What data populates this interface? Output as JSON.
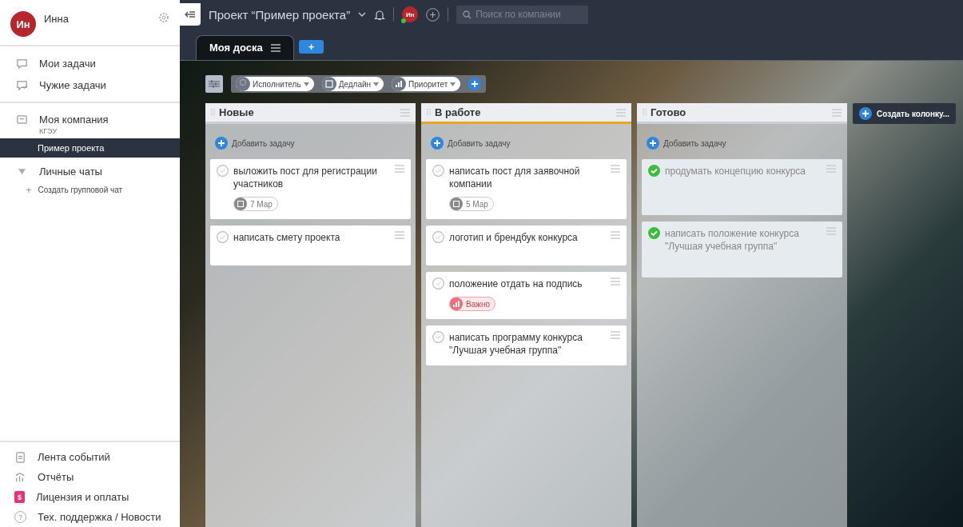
{
  "user": {
    "initials": "Ин",
    "name": "Инна"
  },
  "nav": [
    {
      "label": "Мои задачи",
      "kind": "tasks"
    },
    {
      "label": "Чужие задачи",
      "kind": "others"
    }
  ],
  "company": {
    "name": "Моя компания",
    "subtitle": "КГЭУ",
    "projects": [
      {
        "label": "Пример проекта",
        "selected": true
      }
    ]
  },
  "chats": {
    "label": "Личные чаты",
    "expanded": true,
    "create": "Создать групповой чат",
    "create_icon": "+"
  },
  "footer_nav": [
    {
      "label": "Лента событий",
      "kind": "feed"
    },
    {
      "label": "Отчёты",
      "kind": "reports"
    },
    {
      "label": "Лицензия и оплаты",
      "kind": "license",
      "icon_text": "$"
    },
    {
      "label": "Тех. поддержка / Новости",
      "kind": "help",
      "icon_text": "?"
    }
  ],
  "topbar": {
    "project_title": "Проект “Пример проекта”",
    "avatar": "Ин",
    "online": true,
    "search_placeholder": "Поиск по компании"
  },
  "tabs": [
    {
      "label": "Моя доска",
      "selected": true
    }
  ],
  "add_tab": "+",
  "filters": [
    {
      "label": "Исполнитель",
      "kind": "person"
    },
    {
      "label": "Дедлайн",
      "kind": "date"
    },
    {
      "label": "Приоритет",
      "kind": "priority"
    }
  ],
  "columns": [
    {
      "title": "Новые",
      "color": "#c9ced8",
      "add_label": "Добавить задачу",
      "cards": [
        {
          "text": "выложить пост для регистрации участников",
          "checked": false,
          "tag": {
            "kind": "date",
            "label": "7 Мар"
          }
        },
        {
          "text": "написать смету проекта",
          "checked": false
        }
      ]
    },
    {
      "title": "В работе",
      "color": "#e5a823",
      "add_label": "Добавить задачу",
      "cards": [
        {
          "text": "написать пост для заявочной компании",
          "checked": false,
          "tag": {
            "kind": "date",
            "label": "5 Мар"
          }
        },
        {
          "text": "логотип и брендбук конкурса",
          "checked": false
        },
        {
          "text": "положение отдать на подпись",
          "checked": false,
          "tag": {
            "kind": "priority",
            "label": "Важно"
          }
        },
        {
          "text": "написать программу конкурса \"Лучшая учебная группа\"",
          "checked": false
        }
      ]
    },
    {
      "title": "Готово",
      "color": "#c9ced8",
      "add_label": "Добавить задачу",
      "cards": [
        {
          "text": "продумать концепцию конкурса",
          "checked": true
        },
        {
          "text": "написать положение конкурса \"Лучшая учебная группа\"",
          "checked": true
        }
      ]
    }
  ],
  "create_column": "Создать колонку..."
}
